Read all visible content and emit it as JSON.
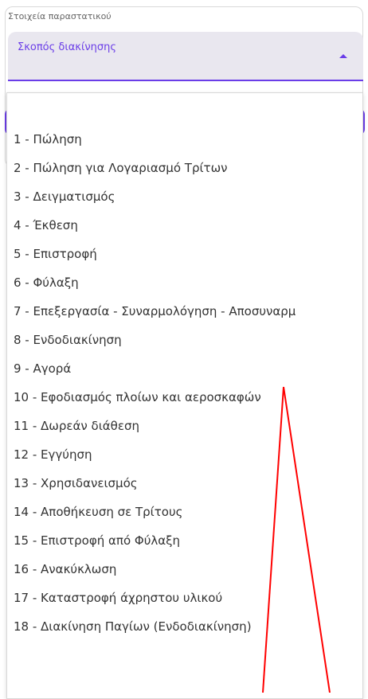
{
  "card": {
    "title": "Στοιχεία παραστατικού"
  },
  "select": {
    "label": "Σκοπός διακίνησης"
  },
  "options": [
    "1 - Πώληση",
    "2 - Πώληση για Λογαριασμό Τρίτων",
    "3 - Δειγματισμός",
    "4 - Έκθεση",
    "5 - Επιστροφή",
    "6 - Φύλαξη",
    "7 - Επεξεργασία - Συναρμολόγηση - Αποσυναρμ",
    "8 - Ενδοδιακίνηση",
    "9 - Αγορά",
    "10 - Εφοδιασμός πλοίων και αεροσκαφών",
    "11 - Δωρεάν διάθεση",
    "12 - Εγγύηση",
    "13 - Χρησιδανεισμός",
    "14 - Αποθήκευση σε Τρίτους",
    "15 - Επιστροφή από Φύλαξη",
    "16 - Ανακύκλωση",
    "17 - Καταστροφή άχρηστου υλικού",
    "18 - Διακίνηση Παγίων (Ενδοδιακίνηση)"
  ],
  "colors": {
    "accent": "#6a3de8",
    "annotation": "#ff0000"
  }
}
